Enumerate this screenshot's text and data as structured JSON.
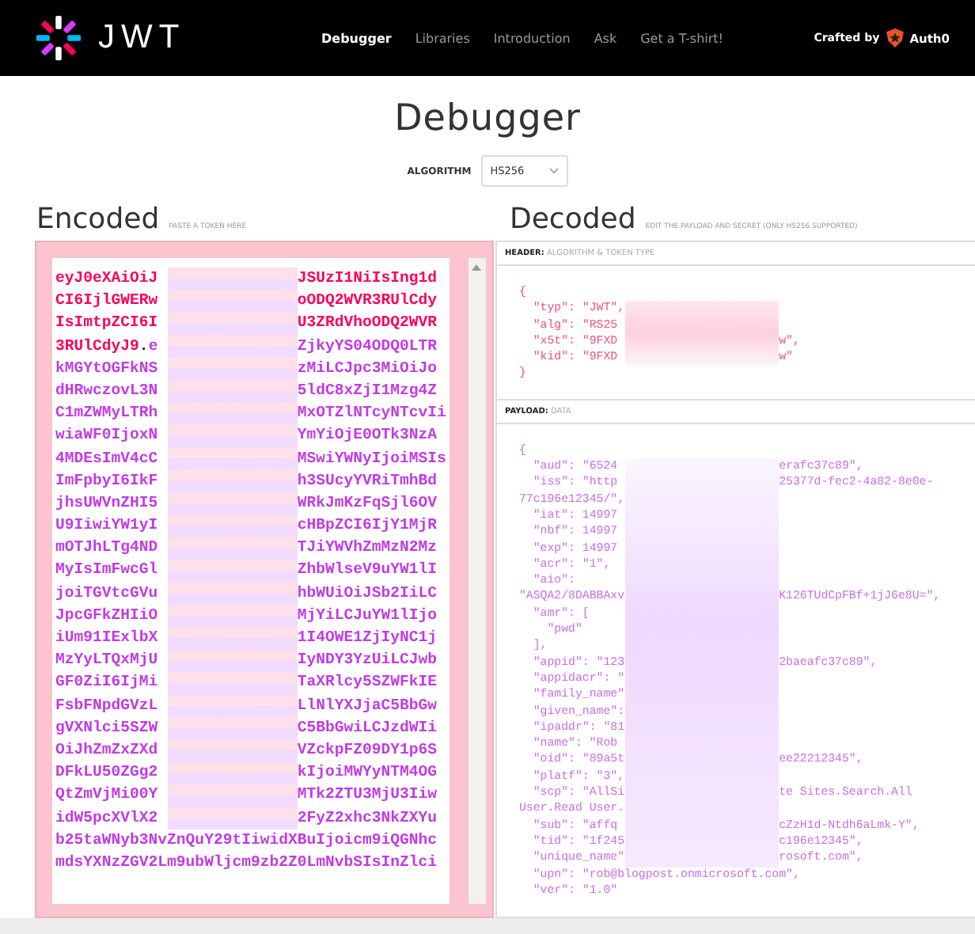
{
  "topbar": {
    "logo_text": "JWT",
    "nav": [
      {
        "label": "Debugger",
        "selected": true
      },
      {
        "label": "Libraries",
        "selected": false
      },
      {
        "label": "Introduction",
        "selected": false
      },
      {
        "label": "Ask",
        "selected": false
      },
      {
        "label": "Get a T-shirt!",
        "selected": false
      }
    ],
    "crafted_by": "Crafted by",
    "brand": "Auth0"
  },
  "page_title": "Debugger",
  "algorithm": {
    "label": "ALGORITHM",
    "value": "HS256"
  },
  "encoded": {
    "title": "Encoded",
    "note": "PASTE A TOKEN HERE",
    "lines": [
      {
        "before": [
          {
            "text": "eyJ0eXAiOiJ",
            "kind": "header"
          }
        ],
        "after": [
          {
            "text": "JSUzI1NiIsIng1d",
            "kind": "header"
          }
        ]
      },
      {
        "before": [
          {
            "text": "CI6IjlGWERw",
            "kind": "header"
          }
        ],
        "after": [
          {
            "text": "oODQ2WVR3RUlCdy",
            "kind": "header"
          }
        ]
      },
      {
        "before": [
          {
            "text": "IsImtpZCI6I",
            "kind": "header"
          }
        ],
        "after": [
          {
            "text": "U3ZRdVhoODQ2WVR",
            "kind": "header"
          }
        ]
      },
      {
        "before": [
          {
            "text": "3RUlCdyJ9",
            "kind": "header"
          },
          {
            "text": ".",
            "kind": "dot"
          },
          {
            "text": "e",
            "kind": "payload"
          }
        ],
        "after": [
          {
            "text": "ZjkyYS04ODQ0LTR",
            "kind": "payload"
          }
        ]
      },
      {
        "before": [
          {
            "text": "kMGYtOGFkNS",
            "kind": "payload"
          }
        ],
        "after": [
          {
            "text": "zMiLCJpc3MiOiJo",
            "kind": "payload"
          }
        ]
      },
      {
        "before": [
          {
            "text": "dHRwczovL3N",
            "kind": "payload"
          }
        ],
        "after": [
          {
            "text": "5ldC8xZjI1Mzg4Z",
            "kind": "payload"
          }
        ]
      },
      {
        "before": [
          {
            "text": "C1mZWMyLTRh",
            "kind": "payload"
          }
        ],
        "after": [
          {
            "text": "MxOTZlNTcyNTcvIi",
            "kind": "payload"
          }
        ]
      },
      {
        "before": [
          {
            "text": "wiaWF0IjoxN",
            "kind": "payload"
          }
        ],
        "after": [
          {
            "text": "YmYiOjE0OTk3NzA",
            "kind": "payload"
          }
        ]
      },
      {
        "before": [
          {
            "text": "4MDEsImV4cC",
            "kind": "payload"
          }
        ],
        "after": [
          {
            "text": "MSwiYWNyIjoiMSIs",
            "kind": "payload"
          }
        ]
      },
      {
        "before": [
          {
            "text": "ImFpbyI6IkF",
            "kind": "payload"
          }
        ],
        "after": [
          {
            "text": "h3SUcyYVRiTmhBd",
            "kind": "payload"
          }
        ]
      },
      {
        "before": [
          {
            "text": "jhsUWVnZHI5",
            "kind": "payload"
          }
        ],
        "after": [
          {
            "text": "WRkJmKzFqSjl6OV",
            "kind": "payload"
          }
        ]
      },
      {
        "before": [
          {
            "text": "U9IiwiYW1yI",
            "kind": "payload"
          }
        ],
        "after": [
          {
            "text": "cHBpZCI6IjY1MjR",
            "kind": "payload"
          }
        ]
      },
      {
        "before": [
          {
            "text": "mOTJhLTg4ND",
            "kind": "payload"
          }
        ],
        "after": [
          {
            "text": "TJiYWVhZmMzN2Mz",
            "kind": "payload"
          }
        ]
      },
      {
        "before": [
          {
            "text": "MyIsImFwcGl",
            "kind": "payload"
          }
        ],
        "after": [
          {
            "text": "ZhbWlseV9uYW1lI",
            "kind": "payload"
          }
        ]
      },
      {
        "before": [
          {
            "text": "joiTGVtcGVu",
            "kind": "payload"
          }
        ],
        "after": [
          {
            "text": "hbWUiOiJSb2IiLC",
            "kind": "payload"
          }
        ]
      },
      {
        "before": [
          {
            "text": "JpcGFkZHIiO",
            "kind": "payload"
          }
        ],
        "after": [
          {
            "text": "MjYiLCJuYW1lIjo",
            "kind": "payload"
          }
        ]
      },
      {
        "before": [
          {
            "text": "iUm91IExlbX",
            "kind": "payload"
          }
        ],
        "after": [
          {
            "text": "1I4OWE1ZjIyNC1j",
            "kind": "payload"
          }
        ]
      },
      {
        "before": [
          {
            "text": "MzYyLTQxMjU",
            "kind": "payload"
          }
        ],
        "after": [
          {
            "text": "IyNDY3YzUiLCJwb",
            "kind": "payload"
          }
        ]
      },
      {
        "before": [
          {
            "text": "GF0ZiI6IjMi",
            "kind": "payload"
          }
        ],
        "after": [
          {
            "text": "TaXRlcy5SZWFkIE",
            "kind": "payload"
          }
        ]
      },
      {
        "before": [
          {
            "text": "FsbFNpdGVzL",
            "kind": "payload"
          }
        ],
        "after": [
          {
            "text": "LlNlYXJjaC5BbGw",
            "kind": "payload"
          }
        ]
      },
      {
        "before": [
          {
            "text": "gVXNlci5SZW",
            "kind": "payload"
          }
        ],
        "after": [
          {
            "text": "C5BbGwiLCJzdWIi",
            "kind": "payload"
          }
        ]
      },
      {
        "before": [
          {
            "text": "OiJhZmZxZXd",
            "kind": "payload"
          }
        ],
        "after": [
          {
            "text": "VZckpFZ09DY1p6S",
            "kind": "payload"
          }
        ]
      },
      {
        "before": [
          {
            "text": "DFkLU50ZGg2",
            "kind": "payload"
          }
        ],
        "after": [
          {
            "text": "kIjoiMWYyNTM4OG",
            "kind": "payload"
          }
        ]
      },
      {
        "before": [
          {
            "text": "QtZmVjMi00Y",
            "kind": "payload"
          }
        ],
        "after": [
          {
            "text": "MTk2ZTU3MjU3Iiw",
            "kind": "payload"
          }
        ]
      },
      {
        "before": [
          {
            "text": "idW5pcXVlX2",
            "kind": "payload"
          }
        ],
        "after": [
          {
            "text": "2FyZ2xhc3NkZXYu",
            "kind": "payload"
          }
        ]
      },
      {
        "before": [
          {
            "text": "b25taWNyb3NvZnQuY29tIiwidXBuIjoicm9iQGNhc",
            "kind": "payload"
          }
        ]
      },
      {
        "before": [
          {
            "text": "mdsYXNzZGV2Lm9ubWljcm9zb2Z0LmNvbSIsInZlci",
            "kind": "payload"
          }
        ]
      }
    ]
  },
  "decoded": {
    "title": "Decoded",
    "note": "EDIT THE PAYLOAD AND SECRET (ONLY HS256 SUPPORTED)",
    "sections": [
      {
        "kind": "header",
        "label": "**HEADER:** ALGORITHM & TOKEN TYPE",
        "lines": [
          {
            "before": "{"
          },
          {
            "before": "  \"typ\": \"JWT\","
          },
          {
            "before": "  \"alg\": \"RS25"
          },
          {
            "before": "  \"x5t\": \"9FXD",
            "after": "w\","
          },
          {
            "before": "  \"kid\": \"9FXD",
            "after": "w\""
          },
          {
            "before": "}"
          }
        ]
      },
      {
        "kind": "payload",
        "label": "**PAYLOAD:** DATA",
        "lines": [
          {
            "before": "{"
          },
          {
            "before": "  \"aud\": \"6524",
            "after": "erafc37c89\","
          },
          {
            "before": "  \"iss\": \"http",
            "after": "25377d-fec2-4a82-8e0e-"
          },
          {
            "before": "77c196e12345/\","
          },
          {
            "before": "  \"iat\": 14997"
          },
          {
            "before": "  \"nbf\": 14997"
          },
          {
            "before": "  \"exp\": 14997"
          },
          {
            "before": "  \"acr\": \"1\","
          },
          {
            "before": "  \"aio\":"
          },
          {
            "before": "\"ASQA2/8DABBAxv",
            "after": "K126TUdCpFBf+1jJ6e8U=\","
          },
          {
            "before": "  \"amr\": ["
          },
          {
            "before": "    \"pwd\""
          },
          {
            "before": "  ],"
          },
          {
            "before": "  \"appid\": \"123",
            "after": "2baeafc37c89\","
          },
          {
            "before": "  \"appidacr\": \""
          },
          {
            "before": "  \"family_name\""
          },
          {
            "before": "  \"given_name\":"
          },
          {
            "before": "  \"ipaddr\": \"81"
          },
          {
            "before": "  \"name\": \"Rob"
          },
          {
            "before": "  \"oid\": \"89a5t",
            "after": "ee22212345\","
          },
          {
            "before": "  \"platf\": \"3\","
          },
          {
            "before": "  \"scp\": \"AllSi",
            "after": "te Sites.Search.All"
          },
          {
            "before": "User.Read User."
          },
          {
            "before": "  \"sub\": \"affq",
            "after": "cZzH1d-Ntdh6aLmk-Y\","
          },
          {
            "before": "  \"tid\": \"1f245",
            "after": "c196e12345\","
          },
          {
            "before": "  \"unique_name\"",
            "after": "rosoft.com\","
          },
          {
            "before": "  \"upn\": \"rob@blogpost.onmicrosoft.com\","
          },
          {
            "before": "  \"ver\": \"1.0\""
          }
        ]
      }
    ]
  }
}
